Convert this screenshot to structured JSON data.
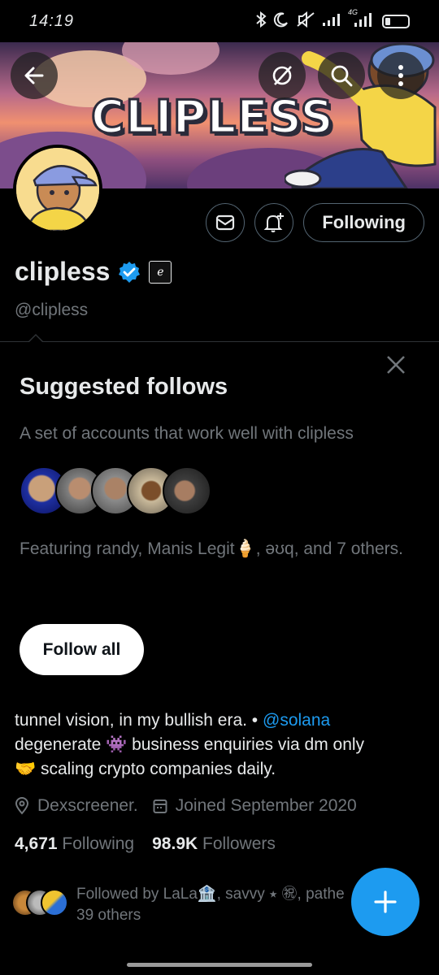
{
  "status_bar": {
    "time": "14:19",
    "icons": [
      "bluetooth-icon",
      "moon-icon",
      "mute-icon",
      "signal-icon",
      "4g-signal-icon",
      "battery-icon"
    ],
    "network_label": "4G"
  },
  "header": {
    "banner_title": "CLIPLESS",
    "back_icon": "arrow-left-icon",
    "grok_icon": "grok-icon",
    "search_icon": "search-icon",
    "more_icon": "more-vertical-icon"
  },
  "profile": {
    "display_name": "clipless",
    "handle": "@clipless",
    "verified_color": "#1d9bf0",
    "affiliate_badge_glyph": "ℯ",
    "following_label": "Following"
  },
  "suggested": {
    "title": "Suggested follows",
    "description": "A set of accounts that work well with clipless",
    "featuring": "Featuring randy, Manis Legit🍦, əʊq, and 7 others.",
    "follow_all_label": "Follow all"
  },
  "bio": {
    "line1_prefix": "tunnel vision, in my bullish era. • ",
    "mention": "@solana",
    "line2": "degenerate 👾 business enquiries via dm only",
    "line3": "🤝 scaling crypto companies daily."
  },
  "meta": {
    "location": "Dexscreener.",
    "joined": "Joined September 2020"
  },
  "stats": {
    "following_count": "4,671",
    "following_label": "Following",
    "followers_count": "98.9K",
    "followers_label": "Followers"
  },
  "followed_by": {
    "line1": "Followed by LaLa🏦, savvy ⭑ ㊗, pathe",
    "line2": "39 others"
  },
  "colors": {
    "accent": "#1d9bf0",
    "background": "#000000",
    "muted_text": "#71767b",
    "border": "#2f3336"
  }
}
